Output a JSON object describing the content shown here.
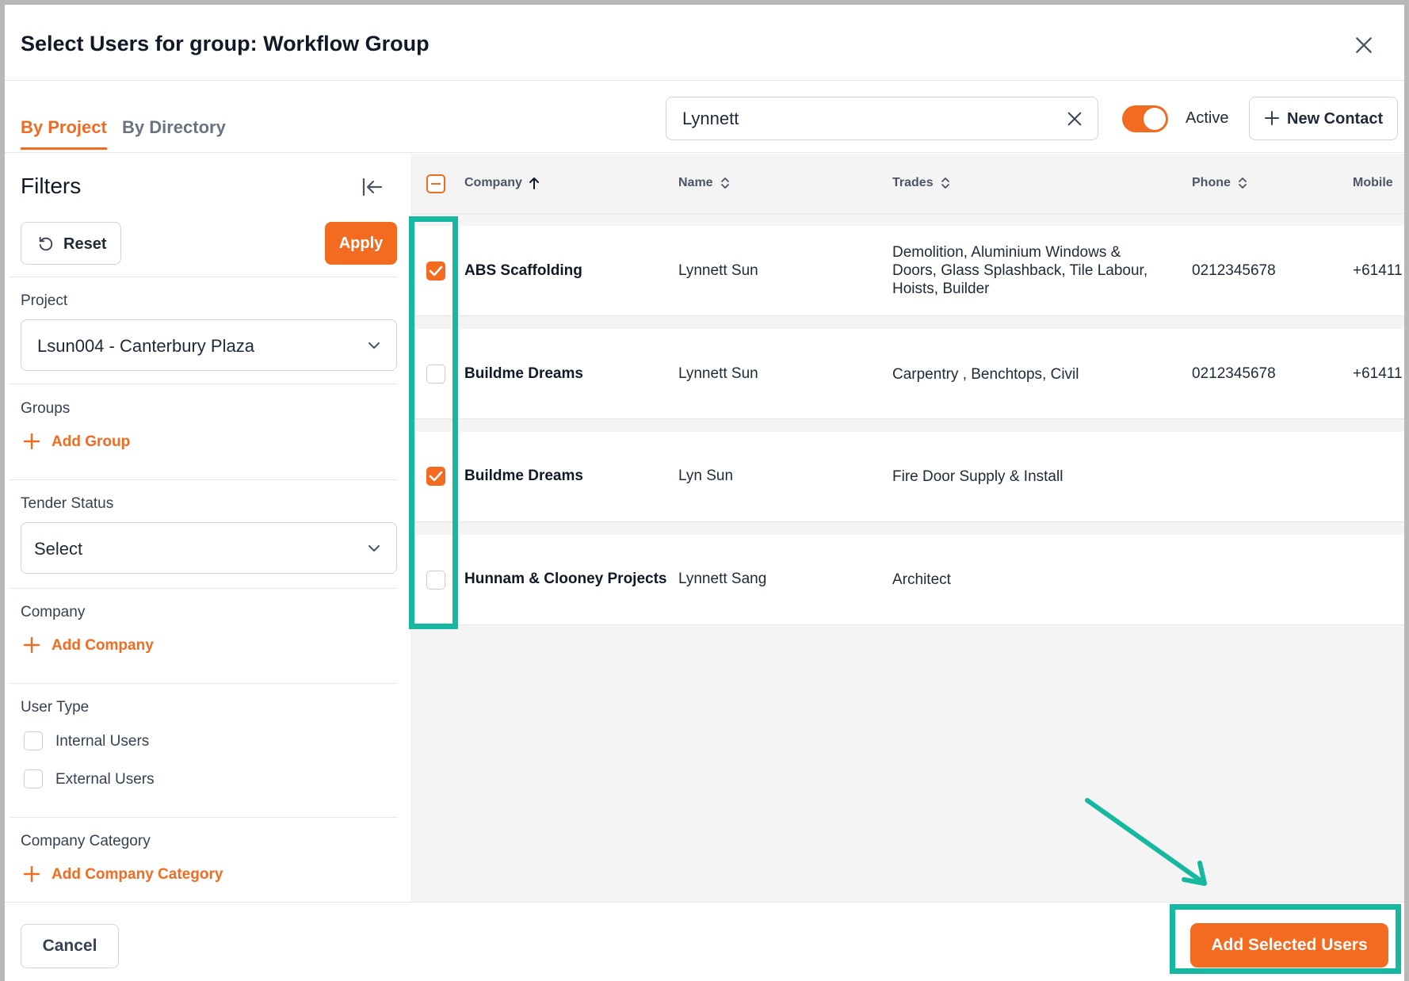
{
  "dialog": {
    "title": "Select Users for group: Workflow Group",
    "close_icon": "close-icon"
  },
  "tabs": [
    {
      "label": "By Project",
      "active": true
    },
    {
      "label": "By Directory",
      "active": false
    }
  ],
  "toolbar": {
    "search_value": "Lynnett",
    "active_toggle": {
      "label": "Active",
      "on": true
    },
    "new_contact_label": "New Contact"
  },
  "filters": {
    "title": "Filters",
    "reset_label": "Reset",
    "apply_label": "Apply",
    "project": {
      "label": "Project",
      "value": "Lsun004 - Canterbury Plaza"
    },
    "groups": {
      "label": "Groups",
      "add_label": "Add Group"
    },
    "tender_status": {
      "label": "Tender Status",
      "value": "Select"
    },
    "company": {
      "label": "Company",
      "add_label": "Add Company"
    },
    "user_type": {
      "label": "User Type",
      "options": [
        {
          "label": "Internal Users",
          "checked": false
        },
        {
          "label": "External Users",
          "checked": false
        }
      ]
    },
    "company_category": {
      "label": "Company Category",
      "add_label": "Add Company Category"
    }
  },
  "table": {
    "columns": [
      "Company",
      "Name",
      "Trades",
      "Phone",
      "Mobile"
    ],
    "sort": {
      "column": "Company",
      "direction": "ascending"
    },
    "rows": [
      {
        "checked": true,
        "company": "ABS Scaffolding",
        "name": "Lynnett Sun",
        "trades": "Demolition, Aluminium Windows & Doors, Glass Splashback, Tile Labour, Hoists, Builder",
        "phone": "0212345678",
        "mobile": "+61411"
      },
      {
        "checked": false,
        "company": "Buildme Dreams",
        "name": "Lynnett Sun",
        "trades": "Carpentry , Benchtops, Civil",
        "phone": "0212345678",
        "mobile": "+61411"
      },
      {
        "checked": true,
        "company": "Buildme Dreams",
        "name": "Lyn Sun",
        "trades": "Fire Door Supply & Install",
        "phone": "",
        "mobile": ""
      },
      {
        "checked": false,
        "company": "Hunnam & Clooney Projects",
        "name": "Lynnett Sang",
        "trades": "Architect",
        "phone": "",
        "mobile": ""
      }
    ]
  },
  "footer": {
    "cancel_label": "Cancel",
    "add_selected_label": "Add Selected Users"
  },
  "colors": {
    "accent": "#f26b21",
    "highlight": "#16b8a0"
  }
}
